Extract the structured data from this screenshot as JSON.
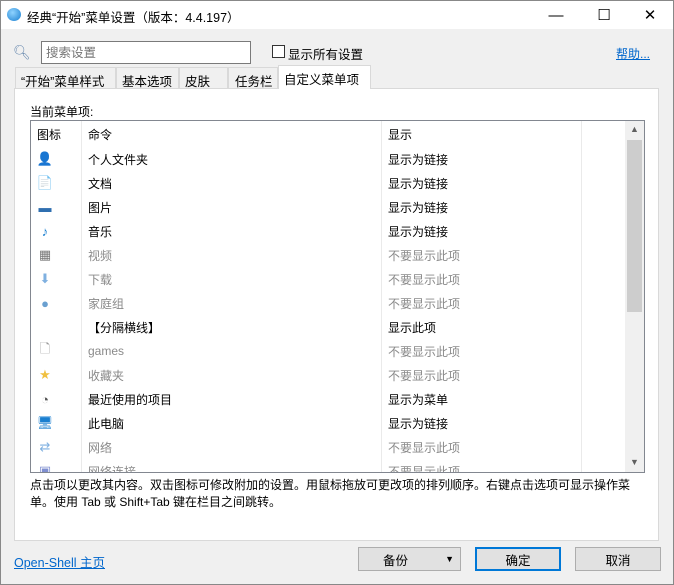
{
  "window": {
    "title": "经典“开始”菜单设置（版本：4.4.197）",
    "minimize": "—",
    "maximize": "☐",
    "close": "✕"
  },
  "top": {
    "search_placeholder": "搜索设置",
    "show_all": "显示所有设置",
    "help": "帮助..."
  },
  "tabs": [
    "“开始”菜单样式",
    "基本选项",
    "皮肤",
    "任务栏",
    "自定义菜单项"
  ],
  "list": {
    "label": "当前菜单项:",
    "headers": [
      "图标",
      "命令",
      "显示"
    ],
    "rows": [
      {
        "icon": "user-folder-icon",
        "glyph": "👤",
        "color": "#3a7a3a",
        "command": "个人文件夹",
        "display": "显示为链接",
        "dim": false
      },
      {
        "icon": "document-icon",
        "glyph": "📄",
        "color": "#3060a0",
        "command": "文档",
        "display": "显示为链接",
        "dim": false
      },
      {
        "icon": "pictures-icon",
        "glyph": "▬",
        "color": "#2f6fb0",
        "command": "图片",
        "display": "显示为链接",
        "dim": false
      },
      {
        "icon": "music-icon",
        "glyph": "♪",
        "color": "#1a7fd0",
        "command": "音乐",
        "display": "显示为链接",
        "dim": false
      },
      {
        "icon": "video-icon",
        "glyph": "▦",
        "color": "#777",
        "command": "视频",
        "display": "不要显示此项",
        "dim": true
      },
      {
        "icon": "download-icon",
        "glyph": "⬇",
        "color": "#7fb0e0",
        "command": "下载",
        "display": "不要显示此项",
        "dim": true
      },
      {
        "icon": "homegroup-icon",
        "glyph": "●",
        "color": "#6aa0d0",
        "command": "家庭组",
        "display": "不要显示此项",
        "dim": true
      },
      {
        "icon": "",
        "glyph": "",
        "color": "#000",
        "command": "【分隔横线】",
        "display": "显示此项",
        "dim": false
      },
      {
        "icon": "blank-file-icon",
        "glyph": "🗋",
        "color": "#999",
        "command": "games",
        "display": "不要显示此项",
        "dim": true
      },
      {
        "icon": "favorites-star-icon",
        "glyph": "★",
        "color": "#f0c040",
        "command": "收藏夹",
        "display": "不要显示此项",
        "dim": true
      },
      {
        "icon": "recent-items-icon",
        "glyph": "◔",
        "color": "#555",
        "command": "最近使用的项目",
        "display": "显示为菜单",
        "dim": false
      },
      {
        "icon": "computer-icon",
        "glyph": "🖥",
        "color": "#1a7fd0",
        "command": "此电脑",
        "display": "显示为链接",
        "dim": false
      },
      {
        "icon": "network-icon",
        "glyph": "⇄",
        "color": "#7fb0e0",
        "command": "网络",
        "display": "不要显示此项",
        "dim": true
      },
      {
        "icon": "network-connections-icon",
        "glyph": "▣",
        "color": "#7f8fd0",
        "command": "网络连接",
        "display": "不要显示此项",
        "dim": true
      }
    ]
  },
  "note": "点击项以更改其内容。双击图标可修改附加的设置。用鼠标拖放可更改项的排列顺序。右键点击选项可显示操作菜单。使用 Tab 或 Shift+Tab 键在栏目之间跳转。",
  "footer": {
    "home_link": "Open-Shell 主页",
    "backup": "备份",
    "ok": "确定",
    "cancel": "取消"
  }
}
